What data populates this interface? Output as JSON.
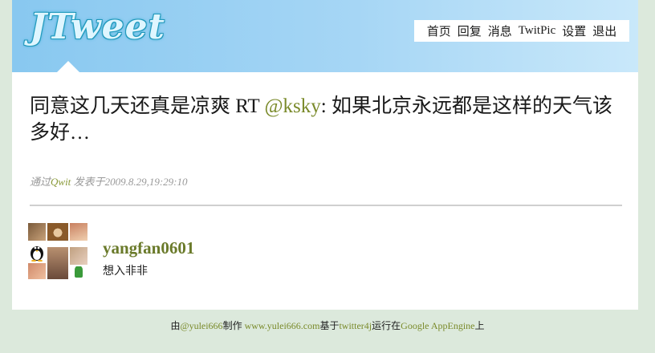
{
  "app": {
    "logo": "JTweet"
  },
  "nav": {
    "items": [
      "首页",
      "回复",
      "消息",
      "TwitPic",
      "设置",
      "退出"
    ]
  },
  "tweet": {
    "text_before": "同意这几天还真是凉爽  RT ",
    "mention": "@ksky",
    "text_after": ": 如果北京永远都是这样的天气该多好…",
    "via_label": "通过",
    "source": "Qwit",
    "posted_label": "发表于",
    "timestamp": "2009.8.29,19:29:10"
  },
  "user": {
    "username": "yangfan0601",
    "bio": "想入非非"
  },
  "footer": {
    "by": "由",
    "author": "@yulei666",
    "made": "制作  ",
    "site": "www.yulei666.com",
    "based_on": "基于",
    "library": "twitter4j",
    "run_on": "运行在",
    "platform": "Google AppEngine",
    "suffix": "上"
  }
}
